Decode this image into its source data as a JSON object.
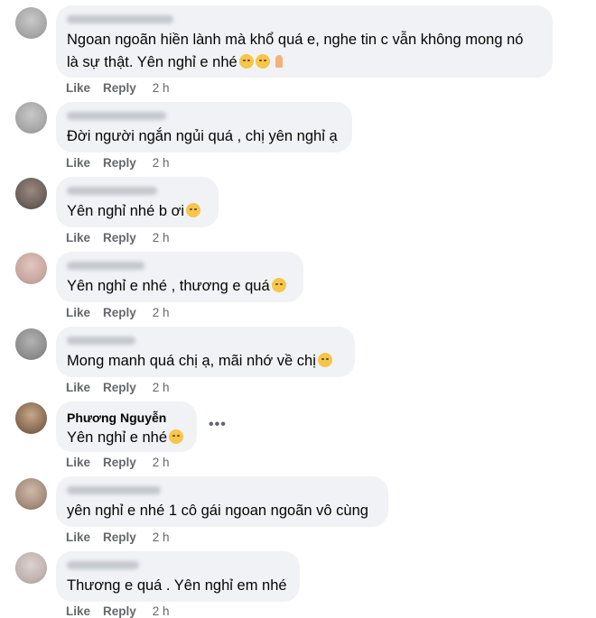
{
  "actions": {
    "like": "Like",
    "reply": "Reply"
  },
  "comments": [
    {
      "name": "",
      "text": "Ngoan ngoãn hiền lành mà khổ quá e, nghe tin c vẫn không mong nó\nlà sự thật. Yên nghỉ e nhé",
      "emojis": [
        "pensive-face-icon",
        "pensive-face-icon",
        "folded-hands-icon"
      ],
      "time": "2 h"
    },
    {
      "name": "",
      "text": "Đời người ngắn ngủi quá , chị yên nghỉ ạ",
      "emojis": [],
      "time": "2 h"
    },
    {
      "name": "",
      "text": "Yên nghỉ nhé b ơi",
      "emojis": [
        "frowning-face-icon"
      ],
      "time": "2 h"
    },
    {
      "name": "",
      "text": "Yên nghỉ e nhé , thương e quá",
      "emojis": [
        "crying-face-icon"
      ],
      "time": "2 h"
    },
    {
      "name": "",
      "text": "Mong manh quá chị ạ, mãi nhớ về chị",
      "emojis": [
        "pleading-face-icon"
      ],
      "time": "2 h"
    },
    {
      "name": "Phương Nguyễn",
      "text": "Yên nghỉ e nhé",
      "emojis": [
        "pensive-face-icon"
      ],
      "time": "2 h",
      "more": "•••"
    },
    {
      "name": "",
      "text": "yên nghỉ e nhé 1 cô gái ngoan ngoãn vô cùng",
      "emojis": [],
      "time": "2 h"
    },
    {
      "name": "",
      "text": "Thương e quá . Yên nghỉ em nhé",
      "emojis": [],
      "time": "2 h"
    }
  ]
}
